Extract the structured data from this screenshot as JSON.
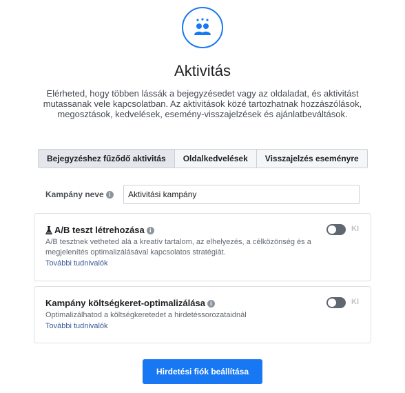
{
  "header": {
    "icon": "people-group-icon",
    "title": "Aktivitás",
    "description": "Elérheted, hogy többen lássák a bejegyzésedet vagy az oldaladat, és aktivitást mutassanak vele kapcsolatban. Az aktivitások közé tartozhatnak hozzászólások, megosztások, kedvelések, esemény-visszajelzések és ajánlatbeváltások."
  },
  "tabs": [
    {
      "label": "Bejegyzéshez fűződő aktivitás",
      "active": true
    },
    {
      "label": "Oldalkedvelések",
      "active": false
    },
    {
      "label": "Visszajelzés eseményre",
      "active": false
    }
  ],
  "campaign": {
    "label": "Kampány neve",
    "value": "Aktivitási kampány"
  },
  "ab_test": {
    "title": "A/B teszt létrehozása",
    "description": "A/B tesztnek vetheted alá a kreatív tartalom, az elhelyezés, a célközönség és a megjelenítés optimalizálásával kapcsolatos stratégiát.",
    "link": "További tudnivalók",
    "toggle_state": "KI"
  },
  "budget_optimization": {
    "title": "Kampány költségkeret-optimalizálása",
    "description": "Optimalizálhatod a költségkeretedet a hirdetéssorozataidnál",
    "link": "További tudnivalók",
    "toggle_state": "KI"
  },
  "footer": {
    "button_label": "Hirdetési fiók beállítása"
  },
  "colors": {
    "accent": "#1877f2",
    "link": "#385898",
    "toggle_off": "#606770"
  }
}
